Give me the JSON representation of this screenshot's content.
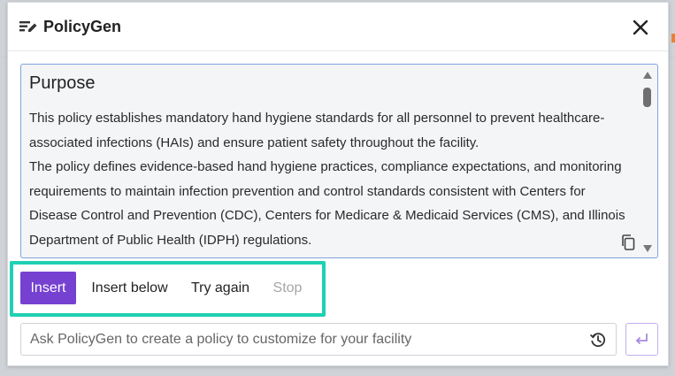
{
  "dialog": {
    "title": "PolicyGen",
    "logo_icon": "edit-note-icon",
    "close_icon": "close-icon"
  },
  "content": {
    "heading": "Purpose",
    "paragraphs": [
      "This policy establishes mandatory hand hygiene standards for all personnel to prevent healthcare-associated infections (HAIs) and ensure patient safety throughout the facility.",
      "The policy defines evidence-based hand hygiene practices, compliance expectations, and monitoring requirements to maintain infection prevention and control standards consistent with Centers for Disease Control and Prevention (CDC), Centers for Medicare & Medicaid Services (CMS), and Illinois Department of Public Health (IDPH) regulations."
    ],
    "copy_icon": "copy-icon"
  },
  "actions": {
    "insert": "Insert",
    "insert_below": "Insert below",
    "try_again": "Try again",
    "stop": "Stop"
  },
  "prompt": {
    "placeholder": "Ask PolicyGen to create a policy to customize for your facility",
    "history_icon": "history-icon",
    "submit_icon": "enter-arrow-icon"
  },
  "colors": {
    "accent_purple": "#7641d0",
    "highlight_teal": "#1fd1b2",
    "content_border_blue": "#7ea4e0"
  }
}
